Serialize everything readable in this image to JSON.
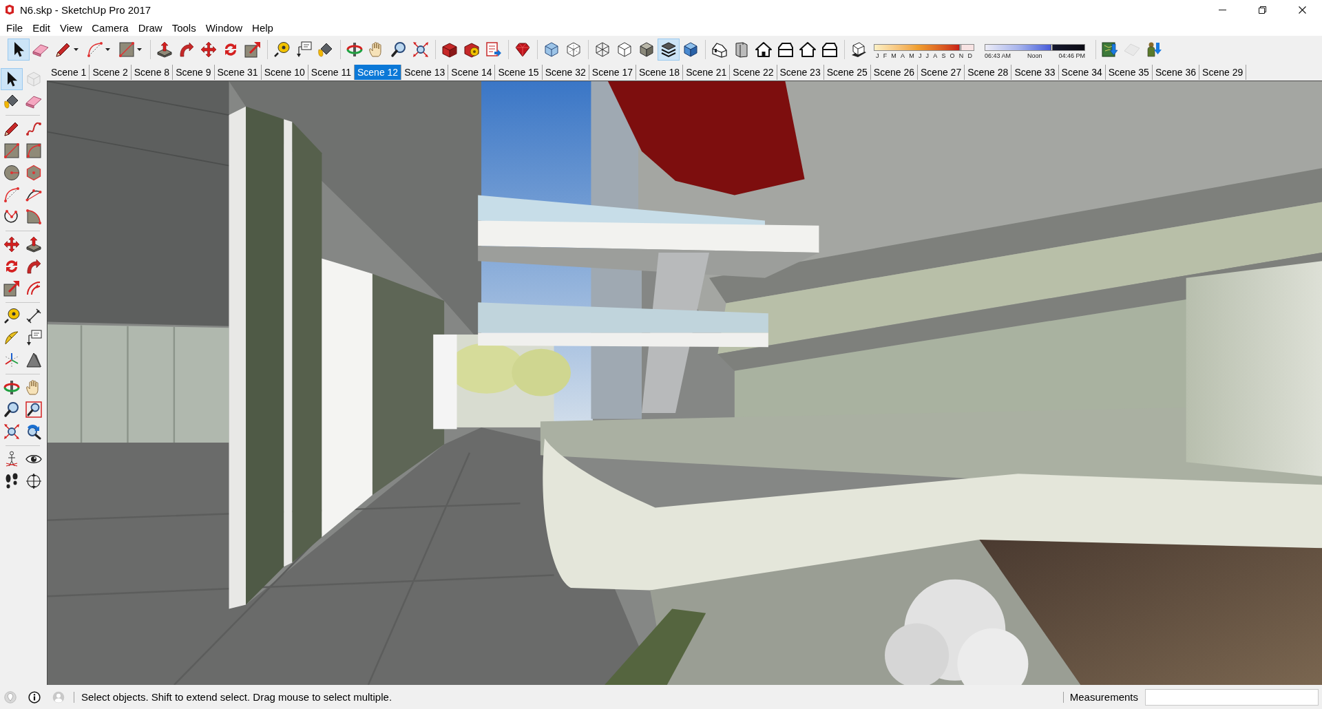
{
  "window": {
    "title": "N6.skp - SketchUp Pro 2017"
  },
  "menu": [
    "File",
    "Edit",
    "View",
    "Camera",
    "Draw",
    "Tools",
    "Window",
    "Help"
  ],
  "toolbar": [
    {
      "kind": "tools",
      "items": [
        {
          "selected": true
        },
        {
          "selected": false
        },
        {
          "selected": false,
          "dropdown": true
        },
        {
          "selected": false,
          "dropdown": true
        },
        {
          "selected": false,
          "dropdown": true
        }
      ]
    },
    {
      "kind": "tools",
      "items": [
        {
          "selected": false
        },
        {
          "selected": false
        },
        {
          "selected": false
        },
        {
          "selected": false
        },
        {
          "selected": false
        }
      ]
    },
    {
      "kind": "tools",
      "items": [
        {
          "selected": false
        },
        {
          "selected": false
        },
        {
          "selected": false
        }
      ]
    },
    {
      "kind": "tools",
      "items": [
        {
          "selected": false
        },
        {
          "selected": false
        },
        {
          "selected": false
        },
        {
          "selected": false
        }
      ]
    },
    {
      "kind": "tools",
      "items": [
        {
          "selected": false
        },
        {
          "selected": false
        },
        {
          "selected": false
        }
      ]
    },
    {
      "kind": "tools",
      "items": [
        {
          "selected": false
        }
      ]
    },
    {
      "kind": "tools",
      "items": [
        {
          "selected": false
        },
        {
          "selected": false
        }
      ]
    },
    {
      "kind": "tools",
      "items": [
        {
          "selected": false
        },
        {
          "selected": false
        },
        {
          "selected": false
        },
        {
          "selected": true
        },
        {
          "selected": false
        }
      ]
    },
    {
      "kind": "tools",
      "items": [
        {
          "selected": false
        },
        {
          "selected": false
        },
        {
          "selected": false
        },
        {
          "selected": false
        },
        {
          "selected": false
        },
        {
          "selected": false
        }
      ]
    },
    {
      "kind": "shadows",
      "items": [
        {
          "selected": false
        }
      ],
      "month_slider": {
        "level": 0.86,
        "labels": [
          "J",
          "F",
          "M",
          "A",
          "M",
          "J",
          "J",
          "A",
          "S",
          "O",
          "N",
          "D"
        ]
      },
      "time_slider": {
        "level": 0.67,
        "labels": [
          "06:43 AM",
          "Noon",
          "04:46 PM"
        ]
      }
    },
    {
      "kind": "tools",
      "items": [
        {
          "selected": false
        },
        {
          "selected": false,
          "disabled": true
        },
        {
          "selected": false
        }
      ]
    }
  ],
  "scenes": [
    {
      "label": "Scene 1",
      "selected": false
    },
    {
      "label": "Scene 2",
      "selected": false
    },
    {
      "label": "Scene 8",
      "selected": false
    },
    {
      "label": "Scene 9",
      "selected": false
    },
    {
      "label": "Scene 31",
      "selected": false
    },
    {
      "label": "Scene 10",
      "selected": false
    },
    {
      "label": "Scene 11",
      "selected": false
    },
    {
      "label": "Scene 12",
      "selected": true
    },
    {
      "label": "Scene 13",
      "selected": false
    },
    {
      "label": "Scene 14",
      "selected": false
    },
    {
      "label": "Scene 15",
      "selected": false
    },
    {
      "label": "Scene 32",
      "selected": false
    },
    {
      "label": "Scene 17",
      "selected": false
    },
    {
      "label": "Scene 18",
      "selected": false
    },
    {
      "label": "Scene 21",
      "selected": false
    },
    {
      "label": "Scene 22",
      "selected": false
    },
    {
      "label": "Scene 23",
      "selected": false
    },
    {
      "label": "Scene 25",
      "selected": false
    },
    {
      "label": "Scene 26",
      "selected": false
    },
    {
      "label": "Scene 27",
      "selected": false
    },
    {
      "label": "Scene 28",
      "selected": false
    },
    {
      "label": "Scene 33",
      "selected": false
    },
    {
      "label": "Scene 34",
      "selected": false
    },
    {
      "label": "Scene 35",
      "selected": false
    },
    {
      "label": "Scene 36",
      "selected": false
    },
    {
      "label": "Scene 29",
      "selected": false
    }
  ],
  "side_toolbar": [
    {
      "items": [
        {
          "selected": true
        },
        {
          "selected": false,
          "disabled": true
        },
        {
          "selected": false
        },
        {
          "selected": false
        }
      ]
    },
    {
      "items": [
        {
          "selected": false
        },
        {
          "selected": false
        },
        {
          "selected": false
        },
        {
          "selected": false
        },
        {
          "selected": false
        },
        {
          "selected": false
        },
        {
          "selected": false
        },
        {
          "selected": false
        },
        {
          "selected": false
        },
        {
          "selected": false
        }
      ]
    },
    {
      "items": [
        {
          "selected": false
        },
        {
          "selected": false
        },
        {
          "selected": false
        },
        {
          "selected": false
        },
        {
          "selected": false
        },
        {
          "selected": false
        }
      ]
    },
    {
      "items": [
        {
          "selected": false
        },
        {
          "selected": false
        },
        {
          "selected": false
        },
        {
          "selected": false
        },
        {
          "selected": false
        },
        {
          "selected": false
        }
      ]
    },
    {
      "items": [
        {
          "selected": false
        },
        {
          "selected": false
        },
        {
          "selected": false
        },
        {
          "selected": false
        },
        {
          "selected": false
        },
        {
          "selected": false
        }
      ]
    },
    {
      "items": [
        {
          "selected": false
        },
        {
          "selected": false
        },
        {
          "selected": false
        },
        {
          "selected": false
        }
      ]
    }
  ],
  "status_bar": {
    "message": "Select objects. Shift to extend select. Drag mouse to select multiple.",
    "measurements_label": "Measurements"
  }
}
